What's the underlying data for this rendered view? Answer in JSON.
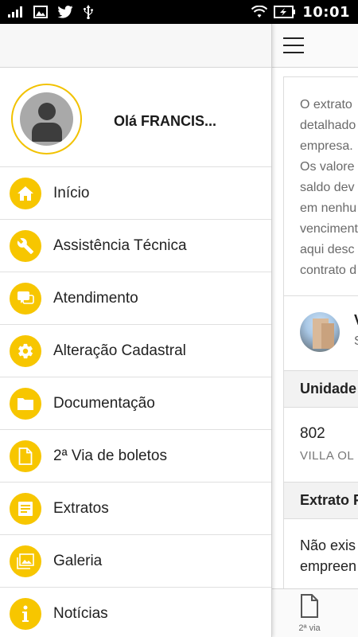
{
  "status_bar": {
    "time": "10:01",
    "left_icons": [
      "signal-icon",
      "image-icon",
      "twitter-icon",
      "usb-icon"
    ],
    "right_icons": [
      "wifi-icon",
      "battery-charging-icon"
    ]
  },
  "drawer": {
    "greeting": "Olá FRANCIS...",
    "accent_color": "#f7c600",
    "menu": [
      {
        "label": "Início",
        "icon": "home-icon"
      },
      {
        "label": "Assistência Técnica",
        "icon": "wrench-icon"
      },
      {
        "label": "Atendimento",
        "icon": "chat-icon"
      },
      {
        "label": "Alteração Cadastral",
        "icon": "gear-icon"
      },
      {
        "label": "Documentação",
        "icon": "folder-icon"
      },
      {
        "label": "2ª Via de boletos",
        "icon": "document-icon"
      },
      {
        "label": "Extratos",
        "icon": "list-document-icon"
      },
      {
        "label": "Galeria",
        "icon": "gallery-icon"
      },
      {
        "label": "Notícias",
        "icon": "info-icon"
      }
    ]
  },
  "background_page": {
    "intro_lines": [
      "O extrato",
      "detalhado",
      "empresa.",
      "Os valore",
      "saldo dev",
      "em nenhu",
      "venciment",
      "aqui desc",
      "contrato d"
    ],
    "project_initial": "V",
    "project_sub_initial": "S",
    "section_unit": "Unidade",
    "unit_number": "802",
    "unit_name": "VILLA OL",
    "section_statement": "Extrato F",
    "empty_lines": [
      "Não exis",
      "empreen"
    ],
    "bottom_tab_label": "2ª via"
  }
}
